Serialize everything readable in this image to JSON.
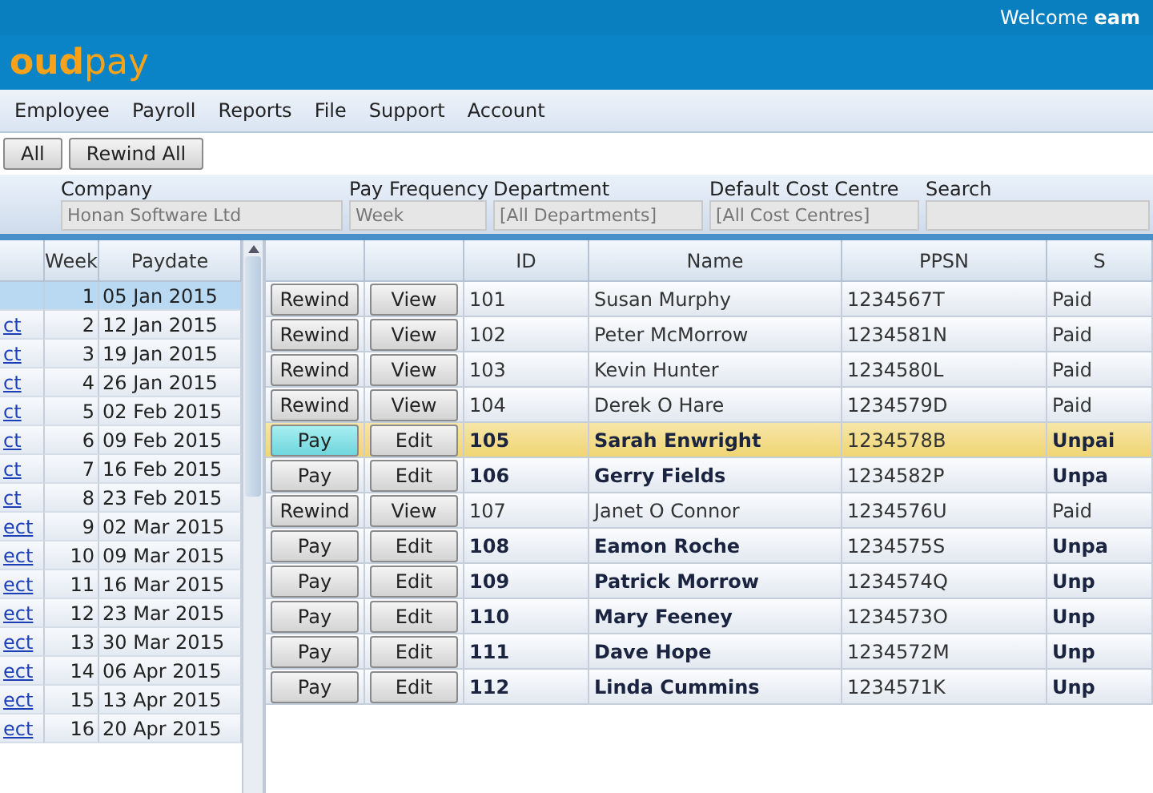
{
  "top_bar": {
    "welcome": "Welcome **eam**"
  },
  "logo": {
    "strong": "oud",
    "light": "pay"
  },
  "menu": [
    "Employee",
    "Payroll",
    "Reports",
    "File",
    "Support",
    "Account"
  ],
  "toolbar": [
    "All",
    "Rewind All"
  ],
  "filters": [
    {
      "label": "Company",
      "value": "Honan Software Ltd"
    },
    {
      "label": "Pay Frequency",
      "value": "Week"
    },
    {
      "label": "Department",
      "value": "[All Departments]"
    },
    {
      "label": "Default Cost Centre",
      "value": "[All Cost Centres]"
    },
    {
      "label": "Search"
    }
  ],
  "periods": {
    "columns": [
      "Week",
      "Paydate"
    ],
    "rows": [
      {
        "link": "",
        "week": "1",
        "paydate": "05 Jan 2015",
        "selected": true
      },
      {
        "link": "ct",
        "week": "2",
        "paydate": "12 Jan 2015",
        "selected": false
      },
      {
        "link": "ct",
        "week": "3",
        "paydate": "19 Jan 2015",
        "selected": false
      },
      {
        "link": "ct",
        "week": "4",
        "paydate": "26 Jan 2015",
        "selected": false
      },
      {
        "link": "ct",
        "week": "5",
        "paydate": "02 Feb 2015",
        "selected": false
      },
      {
        "link": "ct",
        "week": "6",
        "paydate": "09 Feb 2015",
        "selected": false
      },
      {
        "link": "ct",
        "week": "7",
        "paydate": "16 Feb 2015",
        "selected": false
      },
      {
        "link": "ct",
        "week": "8",
        "paydate": "23 Feb 2015",
        "selected": false
      },
      {
        "link": "ect",
        "week": "9",
        "paydate": "02 Mar 2015",
        "selected": false
      },
      {
        "link": "ect",
        "week": "10",
        "paydate": "09 Mar 2015",
        "selected": false
      },
      {
        "link": "ect",
        "week": "11",
        "paydate": "16 Mar 2015",
        "selected": false
      },
      {
        "link": "ect",
        "week": "12",
        "paydate": "23 Mar 2015",
        "selected": false
      },
      {
        "link": "ect",
        "week": "13",
        "paydate": "30 Mar 2015",
        "selected": false
      },
      {
        "link": "ect",
        "week": "14",
        "paydate": "06 Apr 2015",
        "selected": false
      },
      {
        "link": "ect",
        "week": "15",
        "paydate": "13 Apr 2015",
        "selected": false
      },
      {
        "link": "ect",
        "week": "16",
        "paydate": "20 Apr 2015",
        "selected": false
      }
    ]
  },
  "employees": {
    "columns": [
      "ID",
      "Name",
      "PPSN",
      "S"
    ],
    "rows": [
      {
        "action": "Rewind",
        "open": "View",
        "id": "101",
        "name": "Susan Murphy",
        "ppsn": "1234567T",
        "status": "Paid",
        "paid": true,
        "selected": false
      },
      {
        "action": "Rewind",
        "open": "View",
        "id": "102",
        "name": "Peter McMorrow",
        "ppsn": "1234581N",
        "status": "Paid",
        "paid": true,
        "selected": false
      },
      {
        "action": "Rewind",
        "open": "View",
        "id": "103",
        "name": "Kevin Hunter",
        "ppsn": "1234580L",
        "status": "Paid",
        "paid": true,
        "selected": false
      },
      {
        "action": "Rewind",
        "open": "View",
        "id": "104",
        "name": "Derek O Hare",
        "ppsn": "1234579D",
        "status": "Paid",
        "paid": true,
        "selected": false
      },
      {
        "action": "Pay",
        "open": "Edit",
        "id": "105",
        "name": "Sarah Enwright",
        "ppsn": "1234578B",
        "status": "Unpai",
        "paid": false,
        "selected": true
      },
      {
        "action": "Pay",
        "open": "Edit",
        "id": "106",
        "name": "Gerry Fields",
        "ppsn": "1234582P",
        "status": "Unpa",
        "paid": false,
        "selected": false
      },
      {
        "action": "Rewind",
        "open": "View",
        "id": "107",
        "name": "Janet O Connor",
        "ppsn": "1234576U",
        "status": "Paid",
        "paid": true,
        "selected": false
      },
      {
        "action": "Pay",
        "open": "Edit",
        "id": "108",
        "name": "Eamon Roche",
        "ppsn": "1234575S",
        "status": "Unpa",
        "paid": false,
        "selected": false
      },
      {
        "action": "Pay",
        "open": "Edit",
        "id": "109",
        "name": "Patrick Morrow",
        "ppsn": "1234574Q",
        "status": "Unp",
        "paid": false,
        "selected": false
      },
      {
        "action": "Pay",
        "open": "Edit",
        "id": "110",
        "name": "Mary Feeney",
        "ppsn": "1234573O",
        "status": "Unp",
        "paid": false,
        "selected": false
      },
      {
        "action": "Pay",
        "open": "Edit",
        "id": "111",
        "name": "Dave Hope",
        "ppsn": "1234572M",
        "status": "Unp",
        "paid": false,
        "selected": false
      },
      {
        "action": "Pay",
        "open": "Edit",
        "id": "112",
        "name": "Linda Cummins",
        "ppsn": "1234571K",
        "status": "Unp",
        "paid": false,
        "selected": false
      }
    ]
  }
}
